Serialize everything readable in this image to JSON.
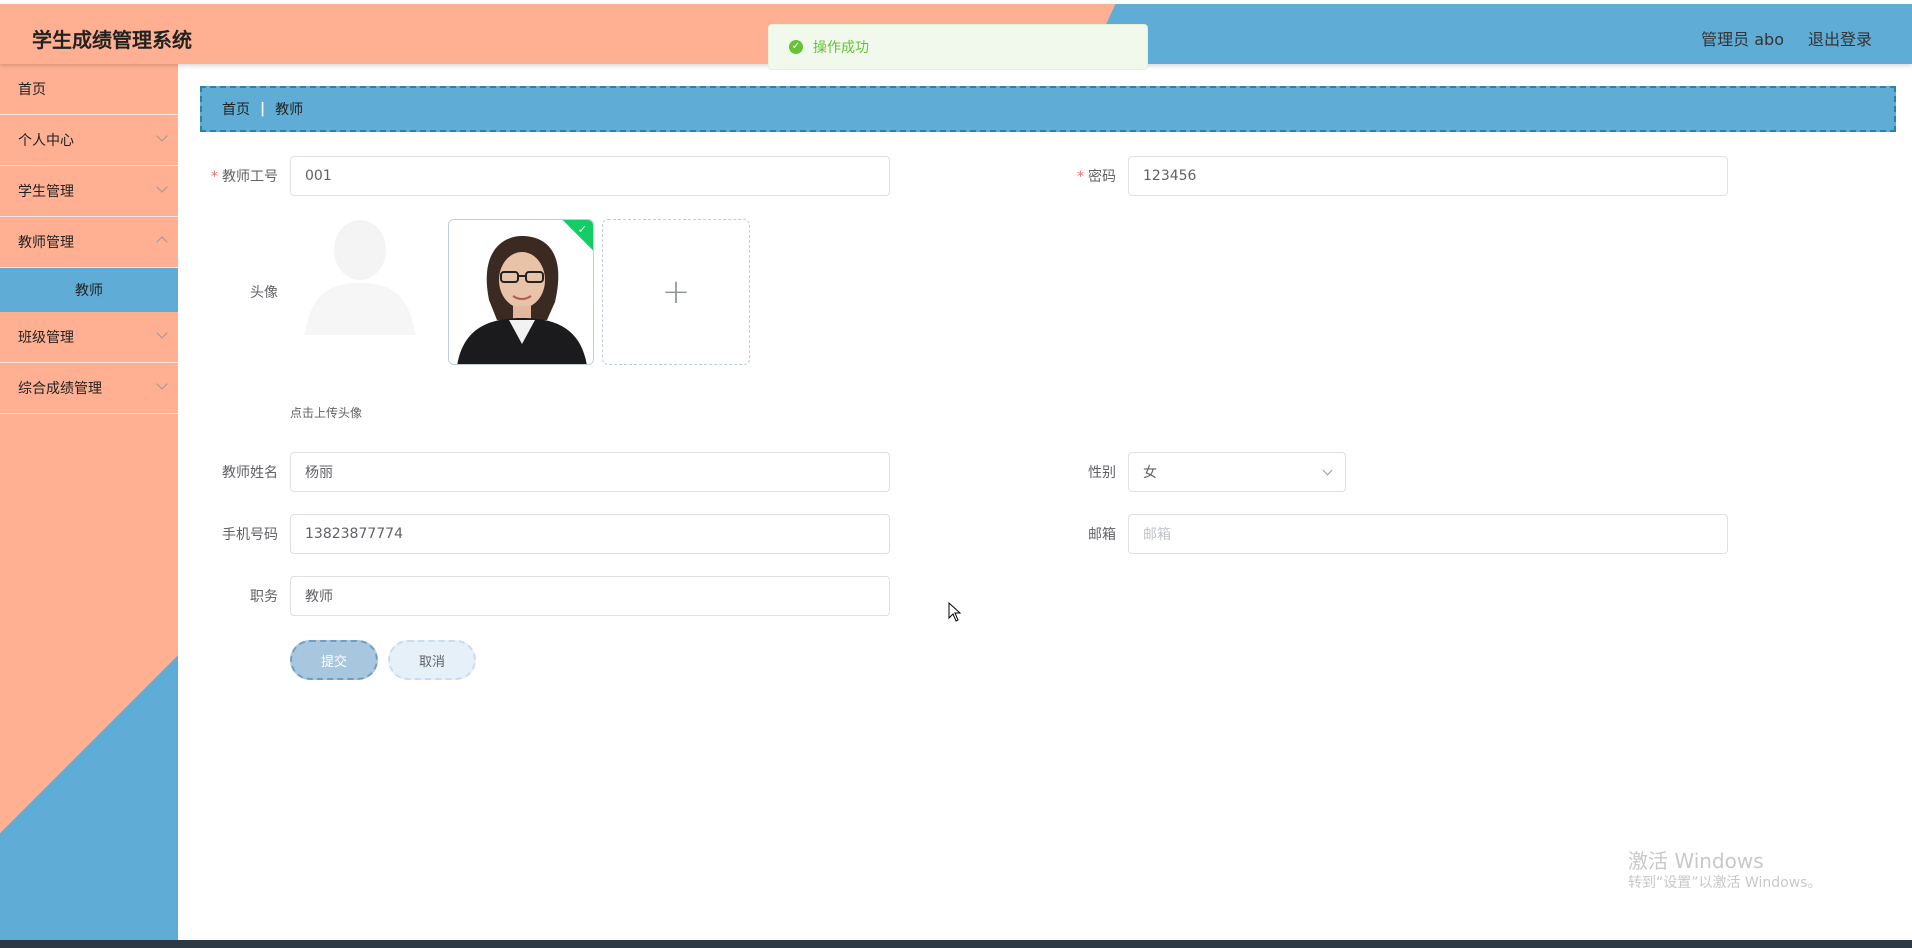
{
  "header": {
    "title": "学生成绩管理系统",
    "admin": "管理员 abo",
    "logout": "退出登录"
  },
  "toast": {
    "message": "操作成功"
  },
  "sidebar": {
    "items": [
      {
        "label": "首页"
      },
      {
        "label": "个人中心"
      },
      {
        "label": "学生管理"
      },
      {
        "label": "教师管理"
      },
      {
        "label": "教师"
      },
      {
        "label": "班级管理"
      },
      {
        "label": "综合成绩管理"
      }
    ]
  },
  "breadcrumb": {
    "home": "首页",
    "current": "教师"
  },
  "form": {
    "teacher_id": {
      "label": "教师工号",
      "value": "001"
    },
    "password": {
      "label": "密码",
      "value": "123456"
    },
    "avatar": {
      "label": "头像",
      "hint": "点击上传头像"
    },
    "name": {
      "label": "教师姓名",
      "value": "杨丽"
    },
    "gender": {
      "label": "性别",
      "value": "女"
    },
    "phone": {
      "label": "手机号码",
      "value": "13823877774"
    },
    "email": {
      "label": "邮箱",
      "placeholder": "邮箱"
    },
    "position": {
      "label": "职务",
      "value": "教师"
    }
  },
  "buttons": {
    "submit": "提交",
    "cancel": "取消"
  },
  "watermark": {
    "line1": "激活 Windows",
    "line2": "转到“设置”以激活 Windows。"
  },
  "colors": {
    "header_peach": "#ffb092",
    "header_blue": "#5fadd6",
    "success": "#67c23a"
  }
}
